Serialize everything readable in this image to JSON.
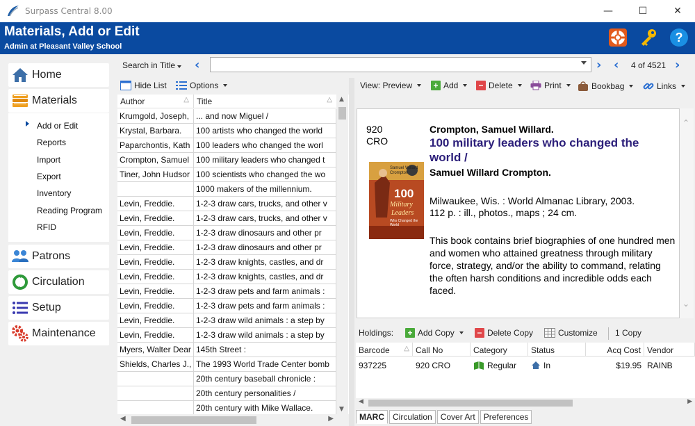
{
  "window": {
    "title": "Surpass Central 8.00",
    "minimize": "—",
    "maximize": "☐",
    "close": "✕"
  },
  "header": {
    "title": "Materials, Add or Edit",
    "subtitle": "Admin at Pleasant Valley School"
  },
  "nav": {
    "items": [
      {
        "label": "Home"
      },
      {
        "label": "Materials"
      },
      {
        "label": "Patrons"
      },
      {
        "label": "Circulation"
      },
      {
        "label": "Setup"
      },
      {
        "label": "Maintenance"
      }
    ],
    "sub_items": [
      "Add or Edit",
      "Reports",
      "Import",
      "Export",
      "Inventory",
      "Reading Program",
      "RFID"
    ]
  },
  "search": {
    "mode": "Search in Title",
    "value": "",
    "record_count": "4 of 4521"
  },
  "list_toolbar": {
    "hide_list": "Hide List",
    "options": "Options"
  },
  "list": {
    "columns": [
      "Author",
      "Title"
    ],
    "rows": [
      [
        "Krumgold, Joseph,",
        "... and now Miguel /"
      ],
      [
        "Krystal, Barbara.",
        "100 artists who changed the world"
      ],
      [
        "Paparchontis, Kath",
        "100 leaders who changed the worl"
      ],
      [
        "Crompton, Samuel",
        "100 military leaders who changed t"
      ],
      [
        "Tiner, John Hudsor",
        "100 scientists who changed the wo"
      ],
      [
        "",
        "1000 makers of the millennium."
      ],
      [
        "Levin, Freddie.",
        "1-2-3 draw cars, trucks, and other v"
      ],
      [
        "Levin, Freddie.",
        "1-2-3 draw cars, trucks, and other v"
      ],
      [
        "Levin, Freddie.",
        "1-2-3 draw dinosaurs and other pr"
      ],
      [
        "Levin, Freddie.",
        "1-2-3 draw dinosaurs and other pr"
      ],
      [
        "Levin, Freddie.",
        "1-2-3 draw knights, castles, and dr"
      ],
      [
        "Levin, Freddie.",
        "1-2-3 draw knights, castles, and dr"
      ],
      [
        "Levin, Freddie.",
        "1-2-3 draw pets and farm animals :"
      ],
      [
        "Levin, Freddie.",
        "1-2-3 draw pets and farm animals :"
      ],
      [
        "Levin, Freddie.",
        "1-2-3 draw wild animals : a step by"
      ],
      [
        "Levin, Freddie.",
        "1-2-3 draw wild animals : a step by"
      ],
      [
        "Myers, Walter Dear",
        "145th Street :"
      ],
      [
        "Shields, Charles J.,",
        "The 1993 World Trade Center bomb"
      ],
      [
        "",
        "20th century baseball chronicle :"
      ],
      [
        "",
        "20th century personalities /"
      ],
      [
        "",
        "20th century with Mike Wallace."
      ]
    ]
  },
  "view_toolbar": {
    "view": "View: Preview",
    "add": "Add",
    "delete": "Delete",
    "print": "Print",
    "bookbag": "Bookbag",
    "links": "Links"
  },
  "preview": {
    "call_number_line1": "920",
    "call_number_line2": "CRO",
    "author": "Crompton, Samuel Willard.",
    "title": "100 military leaders who changed the world /",
    "responsibility": "Samuel Willard Crompton.",
    "publication": "Milwaukee, Wis. : World Almanac Library, 2003.",
    "physical": "112 p. : ill., photos., maps ; 24 cm.",
    "summary": "This book contains brief biographies of one hundred men and women who attained greatness through military force, strategy, and/or the ability to command, relating the often harsh conditions and incredible odds each faced.",
    "cover": {
      "top_text": "Samuel Willard Crompton",
      "number": "100",
      "word1": "Military",
      "word2": "Leaders",
      "bottom_text": "Who Changed the World"
    }
  },
  "holdings": {
    "label": "Holdings:",
    "add_copy": "Add Copy",
    "delete_copy": "Delete Copy",
    "customize": "Customize",
    "copy_count": "1 Copy",
    "columns": [
      "Barcode",
      "Call No",
      "Category",
      "Status",
      "Acq Cost",
      "Vendor"
    ],
    "rows": [
      [
        "937225",
        "920 CRO",
        "Regular",
        "In",
        "$19.95",
        "RAINB"
      ]
    ]
  },
  "tabs": [
    "MARC",
    "Circulation",
    "Cover Art",
    "Preferences"
  ],
  "colors": {
    "header_blue": "#0a4aa0",
    "title_purple": "#2c1f7a",
    "accent_blue": "#2b6fd1"
  }
}
